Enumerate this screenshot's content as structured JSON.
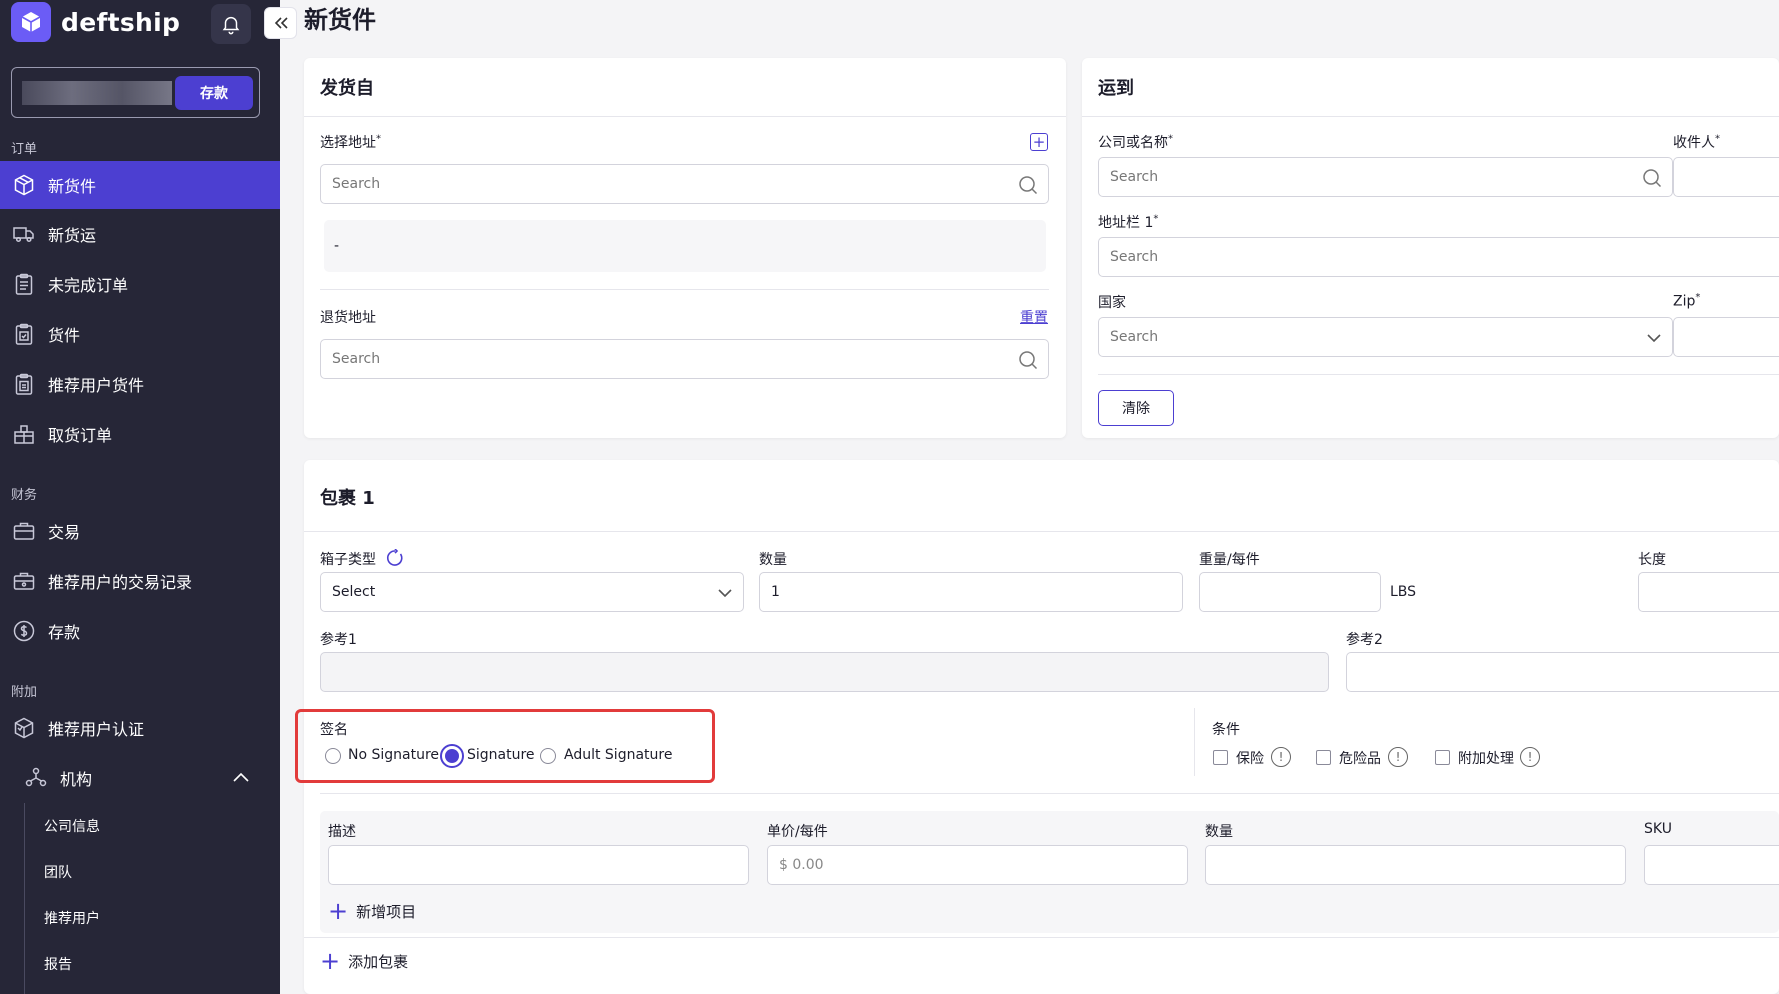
{
  "app": {
    "brand": "deftship",
    "brand_color": "#4c3fd1",
    "wallet_deposit": "存款"
  },
  "sidebar": {
    "sections": {
      "orders": "订单",
      "finance": "财务",
      "extras": "附加"
    },
    "items": [
      {
        "label": "新货件",
        "icon": "box-icon",
        "active": true
      },
      {
        "label": "新货运",
        "icon": "truck-icon"
      },
      {
        "label": "未完成订单",
        "icon": "clipboard-icon"
      },
      {
        "label": "货件",
        "icon": "clipboard-check-icon"
      },
      {
        "label": "推荐用户货件",
        "icon": "clipboard-user-icon"
      },
      {
        "label": "取货订单",
        "icon": "pickup-icon"
      },
      {
        "label": "交易",
        "icon": "briefcase-icon"
      },
      {
        "label": "推荐用户的交易记录",
        "icon": "briefcase-user-icon"
      },
      {
        "label": "存款",
        "icon": "dollar-icon"
      },
      {
        "label": "推荐用户认证",
        "icon": "verify-box-icon"
      },
      {
        "label": "机构",
        "icon": "organization-icon"
      }
    ],
    "sub_items": [
      "公司信息",
      "团队",
      "推荐用户",
      "报告"
    ]
  },
  "page": {
    "title": "新货件"
  },
  "ship_from": {
    "title": "发货自",
    "select_address_label": "选择地址",
    "select_address_placeholder": "Search",
    "address_preview": "-",
    "return_address_label": "退货地址",
    "return_address_placeholder": "Search",
    "reset_link": "重置"
  },
  "ship_to": {
    "title": "运到",
    "company_label": "公司或名称",
    "company_placeholder": "Search",
    "recipient_label": "收件人",
    "address1_label": "地址栏 1",
    "address1_placeholder": "Search",
    "country_label": "国家",
    "country_placeholder": "Search",
    "zip_label": "Zip",
    "clear_button": "清除"
  },
  "package": {
    "title": "包裹 1",
    "box_type_label": "箱子类型",
    "box_type_value": "Select",
    "quantity_label": "数量",
    "quantity_value": "1",
    "weight_label": "重量/每件",
    "weight_unit": "LBS",
    "length_label": "长度",
    "ref1_label": "参考1",
    "ref2_label": "参考2",
    "signature_label": "签名",
    "signature_options": [
      "No Signature",
      "Signature",
      "Adult Signature"
    ],
    "signature_selected": "Signature",
    "conditions_label": "条件",
    "conditions": [
      "保险",
      "危险品",
      "附加处理"
    ],
    "item_description_label": "描述",
    "item_unit_price_label": "单价/每件",
    "item_unit_price_placeholder": "$  0.00",
    "item_quantity_label": "数量",
    "item_sku_label": "SKU",
    "add_item": "新增项目",
    "add_package": "添加包裹"
  }
}
